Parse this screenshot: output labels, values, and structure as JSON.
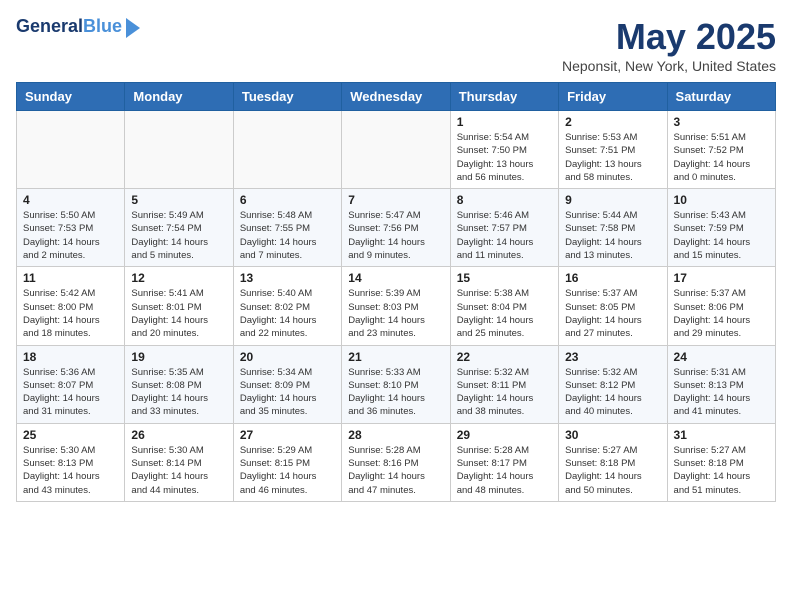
{
  "header": {
    "logo_line1": "General",
    "logo_line2": "Blue",
    "month_title": "May 2025",
    "location": "Neponsit, New York, United States"
  },
  "weekdays": [
    "Sunday",
    "Monday",
    "Tuesday",
    "Wednesday",
    "Thursday",
    "Friday",
    "Saturday"
  ],
  "weeks": [
    [
      {
        "day": "",
        "info": ""
      },
      {
        "day": "",
        "info": ""
      },
      {
        "day": "",
        "info": ""
      },
      {
        "day": "",
        "info": ""
      },
      {
        "day": "1",
        "info": "Sunrise: 5:54 AM\nSunset: 7:50 PM\nDaylight: 13 hours\nand 56 minutes."
      },
      {
        "day": "2",
        "info": "Sunrise: 5:53 AM\nSunset: 7:51 PM\nDaylight: 13 hours\nand 58 minutes."
      },
      {
        "day": "3",
        "info": "Sunrise: 5:51 AM\nSunset: 7:52 PM\nDaylight: 14 hours\nand 0 minutes."
      }
    ],
    [
      {
        "day": "4",
        "info": "Sunrise: 5:50 AM\nSunset: 7:53 PM\nDaylight: 14 hours\nand 2 minutes."
      },
      {
        "day": "5",
        "info": "Sunrise: 5:49 AM\nSunset: 7:54 PM\nDaylight: 14 hours\nand 5 minutes."
      },
      {
        "day": "6",
        "info": "Sunrise: 5:48 AM\nSunset: 7:55 PM\nDaylight: 14 hours\nand 7 minutes."
      },
      {
        "day": "7",
        "info": "Sunrise: 5:47 AM\nSunset: 7:56 PM\nDaylight: 14 hours\nand 9 minutes."
      },
      {
        "day": "8",
        "info": "Sunrise: 5:46 AM\nSunset: 7:57 PM\nDaylight: 14 hours\nand 11 minutes."
      },
      {
        "day": "9",
        "info": "Sunrise: 5:44 AM\nSunset: 7:58 PM\nDaylight: 14 hours\nand 13 minutes."
      },
      {
        "day": "10",
        "info": "Sunrise: 5:43 AM\nSunset: 7:59 PM\nDaylight: 14 hours\nand 15 minutes."
      }
    ],
    [
      {
        "day": "11",
        "info": "Sunrise: 5:42 AM\nSunset: 8:00 PM\nDaylight: 14 hours\nand 18 minutes."
      },
      {
        "day": "12",
        "info": "Sunrise: 5:41 AM\nSunset: 8:01 PM\nDaylight: 14 hours\nand 20 minutes."
      },
      {
        "day": "13",
        "info": "Sunrise: 5:40 AM\nSunset: 8:02 PM\nDaylight: 14 hours\nand 22 minutes."
      },
      {
        "day": "14",
        "info": "Sunrise: 5:39 AM\nSunset: 8:03 PM\nDaylight: 14 hours\nand 23 minutes."
      },
      {
        "day": "15",
        "info": "Sunrise: 5:38 AM\nSunset: 8:04 PM\nDaylight: 14 hours\nand 25 minutes."
      },
      {
        "day": "16",
        "info": "Sunrise: 5:37 AM\nSunset: 8:05 PM\nDaylight: 14 hours\nand 27 minutes."
      },
      {
        "day": "17",
        "info": "Sunrise: 5:37 AM\nSunset: 8:06 PM\nDaylight: 14 hours\nand 29 minutes."
      }
    ],
    [
      {
        "day": "18",
        "info": "Sunrise: 5:36 AM\nSunset: 8:07 PM\nDaylight: 14 hours\nand 31 minutes."
      },
      {
        "day": "19",
        "info": "Sunrise: 5:35 AM\nSunset: 8:08 PM\nDaylight: 14 hours\nand 33 minutes."
      },
      {
        "day": "20",
        "info": "Sunrise: 5:34 AM\nSunset: 8:09 PM\nDaylight: 14 hours\nand 35 minutes."
      },
      {
        "day": "21",
        "info": "Sunrise: 5:33 AM\nSunset: 8:10 PM\nDaylight: 14 hours\nand 36 minutes."
      },
      {
        "day": "22",
        "info": "Sunrise: 5:32 AM\nSunset: 8:11 PM\nDaylight: 14 hours\nand 38 minutes."
      },
      {
        "day": "23",
        "info": "Sunrise: 5:32 AM\nSunset: 8:12 PM\nDaylight: 14 hours\nand 40 minutes."
      },
      {
        "day": "24",
        "info": "Sunrise: 5:31 AM\nSunset: 8:13 PM\nDaylight: 14 hours\nand 41 minutes."
      }
    ],
    [
      {
        "day": "25",
        "info": "Sunrise: 5:30 AM\nSunset: 8:13 PM\nDaylight: 14 hours\nand 43 minutes."
      },
      {
        "day": "26",
        "info": "Sunrise: 5:30 AM\nSunset: 8:14 PM\nDaylight: 14 hours\nand 44 minutes."
      },
      {
        "day": "27",
        "info": "Sunrise: 5:29 AM\nSunset: 8:15 PM\nDaylight: 14 hours\nand 46 minutes."
      },
      {
        "day": "28",
        "info": "Sunrise: 5:28 AM\nSunset: 8:16 PM\nDaylight: 14 hours\nand 47 minutes."
      },
      {
        "day": "29",
        "info": "Sunrise: 5:28 AM\nSunset: 8:17 PM\nDaylight: 14 hours\nand 48 minutes."
      },
      {
        "day": "30",
        "info": "Sunrise: 5:27 AM\nSunset: 8:18 PM\nDaylight: 14 hours\nand 50 minutes."
      },
      {
        "day": "31",
        "info": "Sunrise: 5:27 AM\nSunset: 8:18 PM\nDaylight: 14 hours\nand 51 minutes."
      }
    ]
  ]
}
